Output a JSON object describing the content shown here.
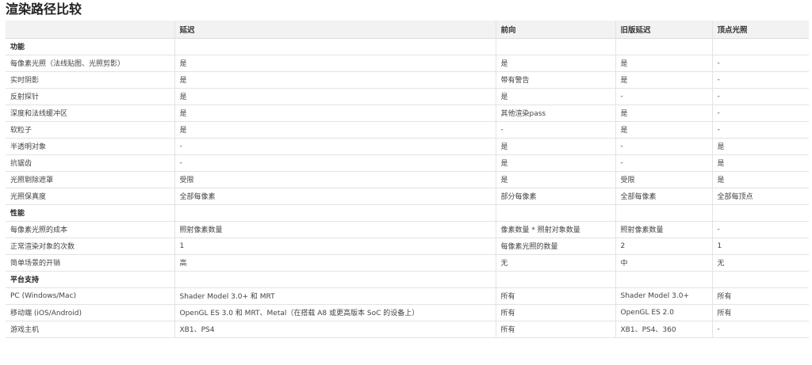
{
  "page": {
    "title": "渲染路径比较"
  },
  "table": {
    "headers": [
      "",
      "延迟",
      "前向",
      "旧版延迟",
      "顶点光照"
    ],
    "sections": [
      {
        "title": "功能",
        "rows": [
          [
            "每像素光照（法线贴图、光照剪影）",
            "是",
            "是",
            "是",
            "-"
          ],
          [
            "实时阴影",
            "是",
            "带有警告",
            "是",
            "-"
          ],
          [
            "反射探针",
            "是",
            "是",
            "-",
            "-"
          ],
          [
            "深度和法线缓冲区",
            "是",
            "其他渲染pass",
            "是",
            "-"
          ],
          [
            "软粒子",
            "是",
            "-",
            "是",
            "-"
          ],
          [
            "半透明对象",
            "-",
            "是",
            "-",
            "是"
          ],
          [
            "抗锯齿",
            "-",
            "是",
            "-",
            "是"
          ],
          [
            "光照剔除遮罩",
            "受限",
            "是",
            "受限",
            "是"
          ],
          [
            "光照保真度",
            "全部每像素",
            "部分每像素",
            "全部每像素",
            "全部每顶点"
          ]
        ]
      },
      {
        "title": "性能",
        "rows": [
          [
            "每像素光照的成本",
            "照射像素数量",
            "像素数量 * 照射对象数量",
            "照射像素数量",
            "-"
          ],
          [
            "正常渲染对象的次数",
            "1",
            "每像素光照的数量",
            "2",
            "1"
          ],
          [
            "简单场景的开销",
            "高",
            "无",
            "中",
            "无"
          ]
        ]
      },
      {
        "title": "平台支持",
        "rows": [
          [
            "PC (Windows/Mac)",
            "Shader Model 3.0+ 和 MRT",
            "所有",
            "Shader Model 3.0+",
            "所有"
          ],
          [
            "移动端 (iOS/Android)",
            "OpenGL ES 3.0 和 MRT、Metal（在搭载 A8 或更高版本 SoC 的设备上）",
            "所有",
            "OpenGL ES 2.0",
            "所有"
          ],
          [
            "游戏主机",
            "XB1、PS4",
            "所有",
            "XB1、PS4、360",
            "-"
          ]
        ]
      }
    ]
  }
}
